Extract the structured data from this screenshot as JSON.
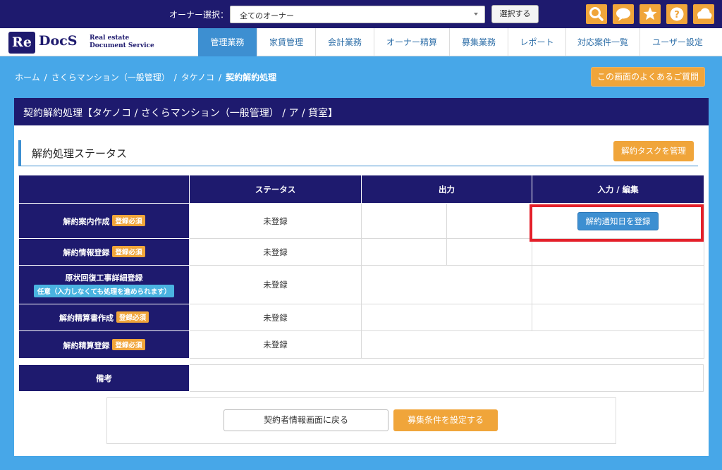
{
  "topbar": {
    "owner_label": "オーナー選択：",
    "owner_select_value": "全てのオーナー",
    "select_button": "選択する",
    "icons": [
      "search-icon",
      "chat-icon",
      "star-icon",
      "help-icon",
      "cloud-icon"
    ],
    "accent_color": "#f0a53a",
    "bg_color": "#1e1a6e"
  },
  "logo": {
    "re": "Re",
    "docs": "DocS",
    "sub_line1": "Real estate",
    "sub_line2": "Document Service"
  },
  "nav": {
    "tabs": [
      {
        "label": "管理業務",
        "active": true
      },
      {
        "label": "家賃管理",
        "active": false
      },
      {
        "label": "会計業務",
        "active": false
      },
      {
        "label": "オーナー精算",
        "active": false
      },
      {
        "label": "募集業務",
        "active": false
      },
      {
        "label": "レポート",
        "active": false
      },
      {
        "label": "対応案件一覧",
        "active": false
      },
      {
        "label": "ユーザー設定",
        "active": false
      }
    ]
  },
  "breadcrumb": {
    "items": [
      "ホーム",
      "さくらマンション（一般管理）",
      "タケノコ",
      "契約解約処理"
    ],
    "separator": "/"
  },
  "faq_button": "この画面のよくあるご質問",
  "panel": {
    "title": "契約解約処理【タケノコ / さくらマンション（一般管理） / ア / 貸室】",
    "section_title": "解約処理ステータス",
    "manage_task_button": "解約タスクを管理"
  },
  "status_table": {
    "headers": [
      "",
      "ステータス",
      "出力",
      "入力 / 編集"
    ],
    "rows": [
      {
        "label": "解約案内作成",
        "badge": "登録必須",
        "status": "未登録",
        "action": "解約通知日を登録"
      },
      {
        "label": "解約情報登録",
        "badge": "登録必須",
        "status": "未登録"
      },
      {
        "label": "原状回復工事詳細登録",
        "optional_badge": "任意（入力しなくても処理を進められます）",
        "status": "未登録"
      },
      {
        "label": "解約精算書作成",
        "badge": "登録必須",
        "status": "未登録"
      },
      {
        "label": "解約精算登録",
        "badge": "登録必須",
        "status": "未登録"
      }
    ]
  },
  "memo": {
    "label": "備考",
    "value": ""
  },
  "footer": {
    "back_button": "契約者情報画面に戻る",
    "condition_button": "募集条件を設定する"
  },
  "highlight_color": "#e4202a"
}
